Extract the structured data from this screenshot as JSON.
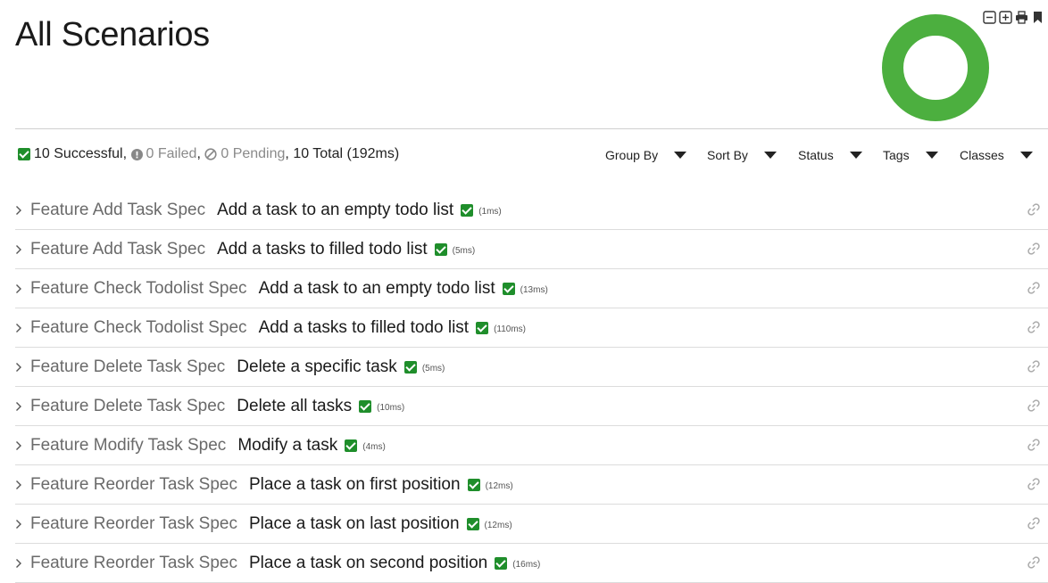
{
  "header": {
    "title": "All Scenarios"
  },
  "toolbar": {
    "icons": [
      "collapse-icon",
      "expand-icon",
      "print-icon",
      "bookmark-icon"
    ]
  },
  "summary": {
    "successful": "10 Successful",
    "failed": "0 Failed",
    "pending": "0 Pending",
    "total": "10 Total (192ms)",
    "sep": ","
  },
  "donut": {
    "successful_fraction": 1.0,
    "color": "#4caf3f"
  },
  "filters": [
    "Group By",
    "Sort By",
    "Status",
    "Tags",
    "Classes"
  ],
  "scenarios": [
    {
      "feature": "Feature Add Task Spec",
      "scenario": "Add a task to an empty todo list",
      "duration": "(1ms)"
    },
    {
      "feature": "Feature Add Task Spec",
      "scenario": "Add a tasks to filled todo list",
      "duration": "(5ms)"
    },
    {
      "feature": "Feature Check Todolist Spec",
      "scenario": "Add a task to an empty todo list",
      "duration": "(13ms)"
    },
    {
      "feature": "Feature Check Todolist Spec",
      "scenario": "Add a tasks to filled todo list",
      "duration": "(110ms)"
    },
    {
      "feature": "Feature Delete Task Spec",
      "scenario": "Delete a specific task",
      "duration": "(5ms)"
    },
    {
      "feature": "Feature Delete Task Spec",
      "scenario": "Delete all tasks",
      "duration": "(10ms)"
    },
    {
      "feature": "Feature Modify Task Spec",
      "scenario": "Modify a task",
      "duration": "(4ms)"
    },
    {
      "feature": "Feature Reorder Task Spec",
      "scenario": "Place a task on first position",
      "duration": "(12ms)"
    },
    {
      "feature": "Feature Reorder Task Spec",
      "scenario": "Place a task on last position",
      "duration": "(12ms)"
    },
    {
      "feature": "Feature Reorder Task Spec",
      "scenario": "Place a task on second position",
      "duration": "(16ms)"
    }
  ]
}
